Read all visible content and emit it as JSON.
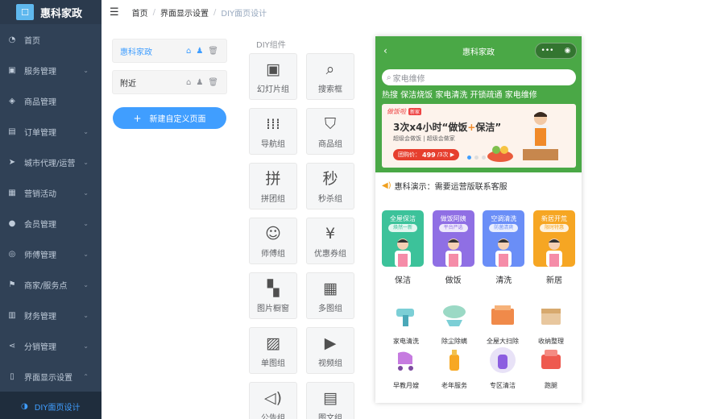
{
  "app": {
    "logo_glyph": "☐",
    "title": "惠科家政"
  },
  "sidebar": {
    "items": [
      {
        "label": "首页",
        "icon": "dashboard-icon",
        "glyph": "◔",
        "arrow": ""
      },
      {
        "label": "服务管理",
        "icon": "briefcase-icon",
        "glyph": "▣",
        "arrow": "⌄"
      },
      {
        "label": "商品管理",
        "icon": "bag-icon",
        "glyph": "◈",
        "arrow": ""
      },
      {
        "label": "订单管理",
        "icon": "order-icon",
        "glyph": "▤",
        "arrow": "⌄"
      },
      {
        "label": "城市代理/运营",
        "icon": "location-icon",
        "glyph": "➤",
        "arrow": "⌄"
      },
      {
        "label": "营销活动",
        "icon": "gift-icon",
        "glyph": "▦",
        "arrow": "⌄"
      },
      {
        "label": "会员管理",
        "icon": "user-icon",
        "glyph": "●",
        "arrow": "⌄"
      },
      {
        "label": "师傅管理",
        "icon": "worker-icon",
        "glyph": "◎",
        "arrow": "⌄"
      },
      {
        "label": "商家/服务点",
        "icon": "flag-icon",
        "glyph": "⚑",
        "arrow": "⌄"
      },
      {
        "label": "财务管理",
        "icon": "finance-icon",
        "glyph": "▥",
        "arrow": "⌄"
      },
      {
        "label": "分销管理",
        "icon": "share-icon",
        "glyph": "⋖",
        "arrow": "⌄"
      },
      {
        "label": "界面显示设置",
        "icon": "display-icon",
        "glyph": "▯",
        "arrow": "⌃"
      }
    ],
    "submenu": {
      "label": "DIY面页设计",
      "icon": "diy-icon",
      "glyph": "◑"
    }
  },
  "header": {
    "breadcrumb": [
      "首页",
      "界面显示设置",
      "DIY面页设计"
    ]
  },
  "pages": {
    "items": [
      {
        "label": "惠科家政",
        "active": true
      },
      {
        "label": "附近",
        "active": false
      }
    ],
    "new_button": "新建自定义页面"
  },
  "components": {
    "title": "DIY组件",
    "items": [
      {
        "label": "幻灯片组",
        "icon": "slideshow-icon",
        "glyph": "▣"
      },
      {
        "label": "搜索框",
        "icon": "search-icon",
        "glyph": "⌕"
      },
      {
        "label": "导航组",
        "icon": "nav-grid-icon",
        "glyph": "⁞⁞⁞"
      },
      {
        "label": "商品组",
        "icon": "shopping-bag-icon",
        "glyph": "⛉"
      },
      {
        "label": "拼团组",
        "icon": "group-buy-icon",
        "glyph": "拼"
      },
      {
        "label": "秒杀组",
        "icon": "flash-sale-icon",
        "glyph": "秒"
      },
      {
        "label": "师傅组",
        "icon": "worker-avatar-icon",
        "glyph": "☺"
      },
      {
        "label": "优惠券组",
        "icon": "coupon-icon",
        "glyph": "¥"
      },
      {
        "label": "图片橱窗",
        "icon": "image-showcase-icon",
        "glyph": "▚"
      },
      {
        "label": "多图组",
        "icon": "multi-image-icon",
        "glyph": "▦"
      },
      {
        "label": "单图组",
        "icon": "single-image-icon",
        "glyph": "▨"
      },
      {
        "label": "视频组",
        "icon": "video-icon",
        "glyph": "▶"
      },
      {
        "label": "公告组",
        "icon": "announcement-icon",
        "glyph": "◁)"
      },
      {
        "label": "图文组",
        "icon": "image-text-icon",
        "glyph": "▤"
      }
    ]
  },
  "phone": {
    "title": "惠科家政",
    "capsule_more": "•••",
    "capsule_close": "◉",
    "search_placeholder": "家电维修",
    "hot": "热搜 保洁烧饭 家电清洗 开锁疏通 家电维修",
    "banner": {
      "tag": "做饭啦",
      "badge": "新家",
      "headline_a": "3次x4小时“做饭",
      "headline_plus": "+",
      "headline_b": "保洁”",
      "sub": "超级会做饭 | 超级会做家",
      "price_prefix": "团购价：",
      "price": "499",
      "price_suffix": "/3次 ▶"
    },
    "notice": "惠科演示：需要运营版联系客服",
    "cards": [
      {
        "title": "全屋保洁",
        "pill": "焕然一新",
        "label": "保洁",
        "color": "#3cc29a"
      },
      {
        "title": "做饭阿姨",
        "pill": "平台严选",
        "label": "做饭",
        "color": "#8f6fe4"
      },
      {
        "title": "空调清洗",
        "pill": "防菌清爽",
        "label": "清洗",
        "color": "#6a8ef7"
      },
      {
        "title": "新居开荒",
        "pill": "限时特惠",
        "label": "新居",
        "color": "#f6a623"
      }
    ],
    "icons": [
      {
        "label": "家电清洗",
        "name": "drill-icon"
      },
      {
        "label": "除尘除螨",
        "name": "vacuum-icon"
      },
      {
        "label": "全屋大扫除",
        "name": "cleaning-box-icon"
      },
      {
        "label": "收纳整理",
        "name": "storage-box-icon"
      },
      {
        "label": "早教月嫂",
        "name": "stroller-icon"
      },
      {
        "label": "老年服务",
        "name": "spray-icon"
      },
      {
        "label": "专区清洁",
        "name": "detergent-icon"
      },
      {
        "label": "跑腿",
        "name": "errand-icon"
      }
    ]
  }
}
